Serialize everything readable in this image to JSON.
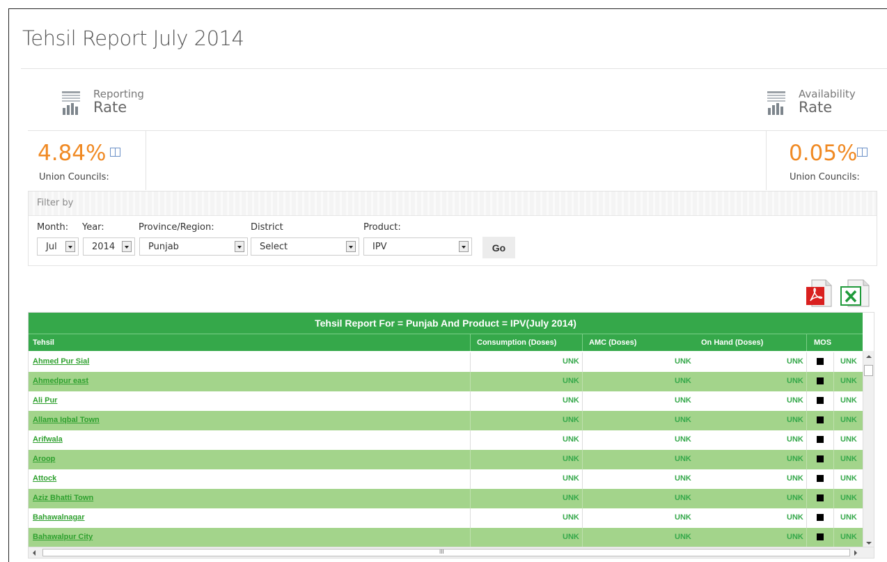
{
  "page": {
    "title": "Tehsil Report July 2014"
  },
  "reporting": {
    "line1": "Reporting",
    "line2": "Rate",
    "value": "4.84%",
    "sub": "Union Councils:"
  },
  "availability": {
    "line1": "Availability",
    "line2": "Rate",
    "value": "0.05%",
    "sub": "Union Councils:"
  },
  "filter": {
    "heading": "Filter by",
    "month": {
      "label": "Month:",
      "value": "Jul"
    },
    "year": {
      "label": "Year:",
      "value": "2014"
    },
    "province": {
      "label": "Province/Region:",
      "value": "Punjab"
    },
    "district": {
      "label": "District",
      "value": "Select"
    },
    "product": {
      "label": "Product:",
      "value": "IPV"
    },
    "go_label": "Go"
  },
  "export": {
    "pdf_icon": "pdf-icon",
    "excel_icon": "excel-icon"
  },
  "grid": {
    "title": "Tehsil Report For = Punjab And Product = IPV(July 2014)",
    "columns": [
      "Tehsil",
      "Consumption (Doses)",
      "AMC (Doses)",
      "On Hand (Doses)",
      "MOS"
    ],
    "rows": [
      {
        "tehsil": "Ahmed Pur Sial",
        "consumption": "UNK",
        "amc": "UNK",
        "on_hand": "UNK",
        "mos": "UNK"
      },
      {
        "tehsil": "Ahmedpur east",
        "consumption": "UNK",
        "amc": "UNK",
        "on_hand": "UNK",
        "mos": "UNK"
      },
      {
        "tehsil": "Ali Pur",
        "consumption": "UNK",
        "amc": "UNK",
        "on_hand": "UNK",
        "mos": "UNK"
      },
      {
        "tehsil": "Allama Iqbal Town",
        "consumption": "UNK",
        "amc": "UNK",
        "on_hand": "UNK",
        "mos": "UNK"
      },
      {
        "tehsil": "Arifwala",
        "consumption": "UNK",
        "amc": "UNK",
        "on_hand": "UNK",
        "mos": "UNK"
      },
      {
        "tehsil": "Aroop",
        "consumption": "UNK",
        "amc": "UNK",
        "on_hand": "UNK",
        "mos": "UNK"
      },
      {
        "tehsil": "Attock",
        "consumption": "UNK",
        "amc": "UNK",
        "on_hand": "UNK",
        "mos": "UNK"
      },
      {
        "tehsil": "Aziz Bhatti Town",
        "consumption": "UNK",
        "amc": "UNK",
        "on_hand": "UNK",
        "mos": "UNK"
      },
      {
        "tehsil": "Bahawalnagar",
        "consumption": "UNK",
        "amc": "UNK",
        "on_hand": "UNK",
        "mos": "UNK"
      },
      {
        "tehsil": "Bahawalpur City",
        "consumption": "UNK",
        "amc": "UNK",
        "on_hand": "UNK",
        "mos": "UNK"
      }
    ],
    "scrollbar": {
      "grip": "III"
    }
  },
  "colors": {
    "orange": "#f08a24",
    "green_header": "#35a84a",
    "green_row": "#a3d48b",
    "link_green": "#2ea02e"
  }
}
